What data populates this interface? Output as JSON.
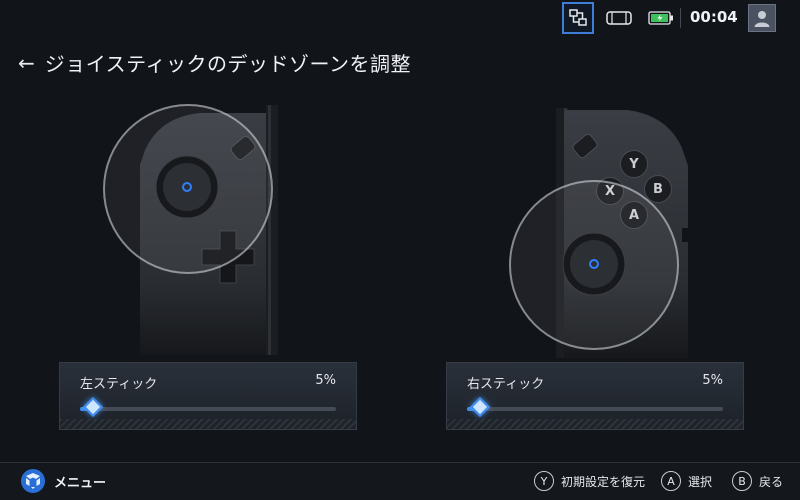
{
  "status": {
    "time": "00:04",
    "icons": [
      "network-icon",
      "controller-icon",
      "battery-charging-icon",
      "user-avatar-icon"
    ],
    "accent": "#3f7dd6",
    "battery_color": "#3ec15a"
  },
  "header": {
    "back_symbol": "←",
    "title": "ジョイスティックのデッドゾーンを調整"
  },
  "controllers": {
    "right_buttons": [
      "Y",
      "X",
      "B",
      "A"
    ]
  },
  "sliders": {
    "left": {
      "label": "左スティック",
      "value_text": "5%",
      "value": 0.05
    },
    "right": {
      "label": "右スティック",
      "value_text": "5%",
      "value": 0.05
    }
  },
  "footer": {
    "menu_label": "メニュー",
    "hints": [
      {
        "key": "Y",
        "label": "初期設定を復元"
      },
      {
        "key": "A",
        "label": "選択"
      },
      {
        "key": "B",
        "label": "戻る"
      }
    ]
  },
  "colors": {
    "background": "#111419",
    "slider_accent": "#3f8ef0",
    "stick_led": "#2f7fff"
  }
}
